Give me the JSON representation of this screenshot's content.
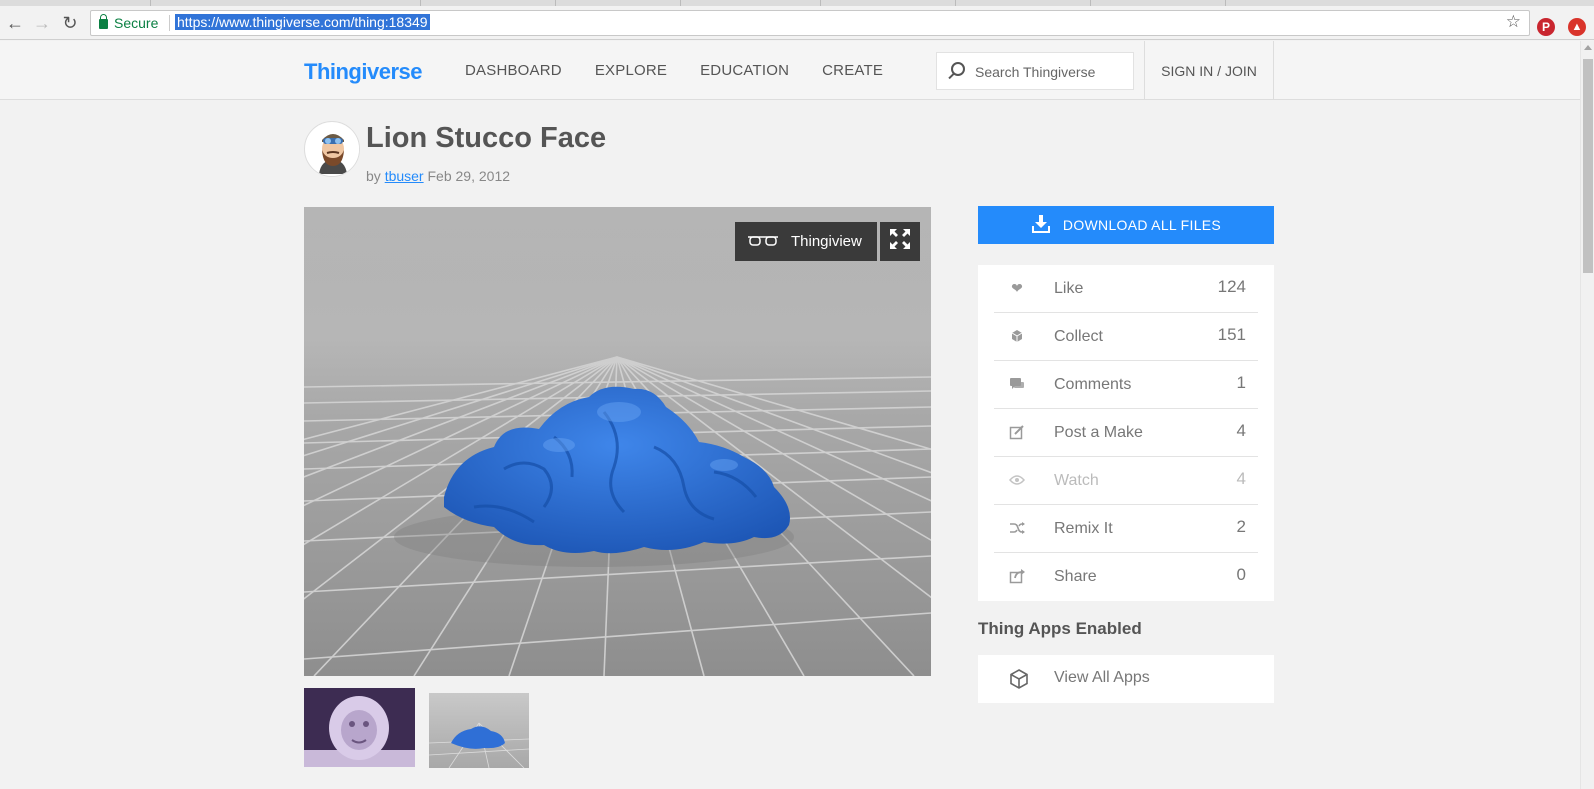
{
  "browser": {
    "secure_label": "Secure",
    "url": "https://www.thingiverse.com/thing:18349"
  },
  "header": {
    "logo": "Thingiverse",
    "nav": [
      "DASHBOARD",
      "EXPLORE",
      "EDUCATION",
      "CREATE"
    ],
    "search_placeholder": "Search Thingiverse",
    "signin": "SIGN IN / JOIN"
  },
  "thing": {
    "title": "Lion Stucco Face",
    "by": "by",
    "author": "tbuser",
    "date": "Feb 29, 2012"
  },
  "viewer": {
    "thingiview_label": "Thingiview",
    "model_color": "#2f6fd6"
  },
  "sidebar": {
    "download_label": "DOWNLOAD ALL FILES",
    "stats": [
      {
        "icon": "heart-icon",
        "label": "Like",
        "count": "124"
      },
      {
        "icon": "collect-icon",
        "label": "Collect",
        "count": "151"
      },
      {
        "icon": "comments-icon",
        "label": "Comments",
        "count": "1"
      },
      {
        "icon": "post-make-icon",
        "label": "Post a Make",
        "count": "4"
      },
      {
        "icon": "eye-icon",
        "label": "Watch",
        "count": "4"
      },
      {
        "icon": "remix-icon",
        "label": "Remix It",
        "count": "2"
      },
      {
        "icon": "share-icon",
        "label": "Share",
        "count": "0"
      }
    ],
    "apps_heading": "Thing Apps Enabled",
    "apps_link": "View All Apps"
  },
  "colors": {
    "brand": "#248bfb",
    "dark_button": "#3a3a3a"
  }
}
